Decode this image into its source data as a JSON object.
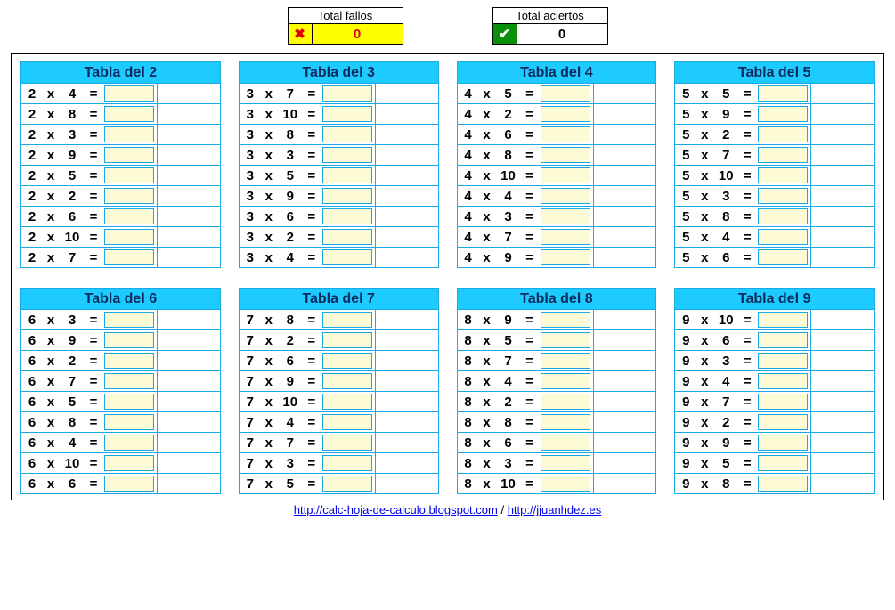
{
  "score": {
    "fail_title": "Total fallos",
    "fail_value": "0",
    "ok_title": "Total aciertos",
    "ok_value": "0"
  },
  "op_symbol": "x",
  "eq_symbol": "=",
  "tables": [
    {
      "title": "Tabla del 2",
      "a": 2,
      "bs": [
        4,
        8,
        3,
        9,
        5,
        2,
        6,
        10,
        7
      ]
    },
    {
      "title": "Tabla del 3",
      "a": 3,
      "bs": [
        7,
        10,
        8,
        3,
        5,
        9,
        6,
        2,
        4
      ]
    },
    {
      "title": "Tabla del 4",
      "a": 4,
      "bs": [
        5,
        2,
        6,
        8,
        10,
        4,
        3,
        7,
        9
      ]
    },
    {
      "title": "Tabla del 5",
      "a": 5,
      "bs": [
        5,
        9,
        2,
        7,
        10,
        3,
        8,
        4,
        6
      ]
    },
    {
      "title": "Tabla del 6",
      "a": 6,
      "bs": [
        3,
        9,
        2,
        7,
        5,
        8,
        4,
        10,
        6
      ]
    },
    {
      "title": "Tabla del 7",
      "a": 7,
      "bs": [
        8,
        2,
        6,
        9,
        10,
        4,
        7,
        3,
        5
      ]
    },
    {
      "title": "Tabla del 8",
      "a": 8,
      "bs": [
        9,
        5,
        7,
        4,
        2,
        8,
        6,
        3,
        10
      ]
    },
    {
      "title": "Tabla del 9",
      "a": 9,
      "bs": [
        10,
        6,
        3,
        4,
        7,
        2,
        9,
        5,
        8
      ]
    }
  ],
  "footer": {
    "link1_text": "http://calc-hoja-de-calculo.blogspot.com",
    "sep": "  /  ",
    "link2_text": "http://jjuanhdez.es"
  }
}
